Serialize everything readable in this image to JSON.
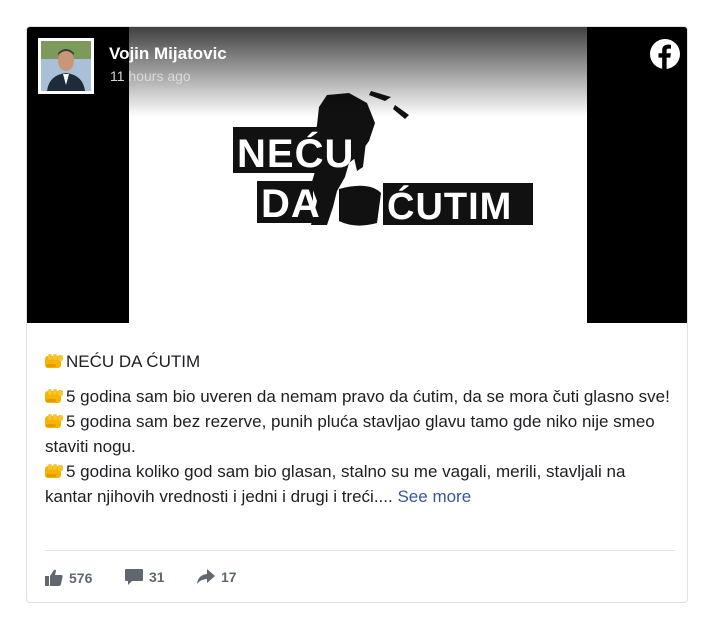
{
  "post": {
    "author": "Vojin Mijatovic",
    "timestamp": "11 hours ago",
    "image_logo_lines": [
      "NEĆU",
      "DA",
      "ĆUTIM"
    ],
    "title": "NEĆU DA ĆUTIM",
    "paragraphs": [
      "5 godina sam bio uveren da nemam pravo da ćutim, da se mora čuti glasno sve!",
      "5 godina sam bez rezerve, punih pluća stavljao glavu tamo gde niko nije smeo staviti nogu.",
      "5 godina koliko god sam bio glasan, stalno su me vagali, merili, stavljali na kantar njihovih vrednosti i jedni i drugi i treći...."
    ],
    "see_more": "See more"
  },
  "stats": {
    "likes": "576",
    "comments": "31",
    "shares": "17"
  },
  "icons": {
    "platform": "facebook-icon",
    "emoji": "oncoming-fist-icon",
    "like": "thumbs-up-icon",
    "comment": "comment-icon",
    "share": "share-arrow-icon"
  },
  "colors": {
    "link": "#365899",
    "facebook": "#ffffff",
    "stat_text": "#606770",
    "fist": "#f5b400"
  }
}
